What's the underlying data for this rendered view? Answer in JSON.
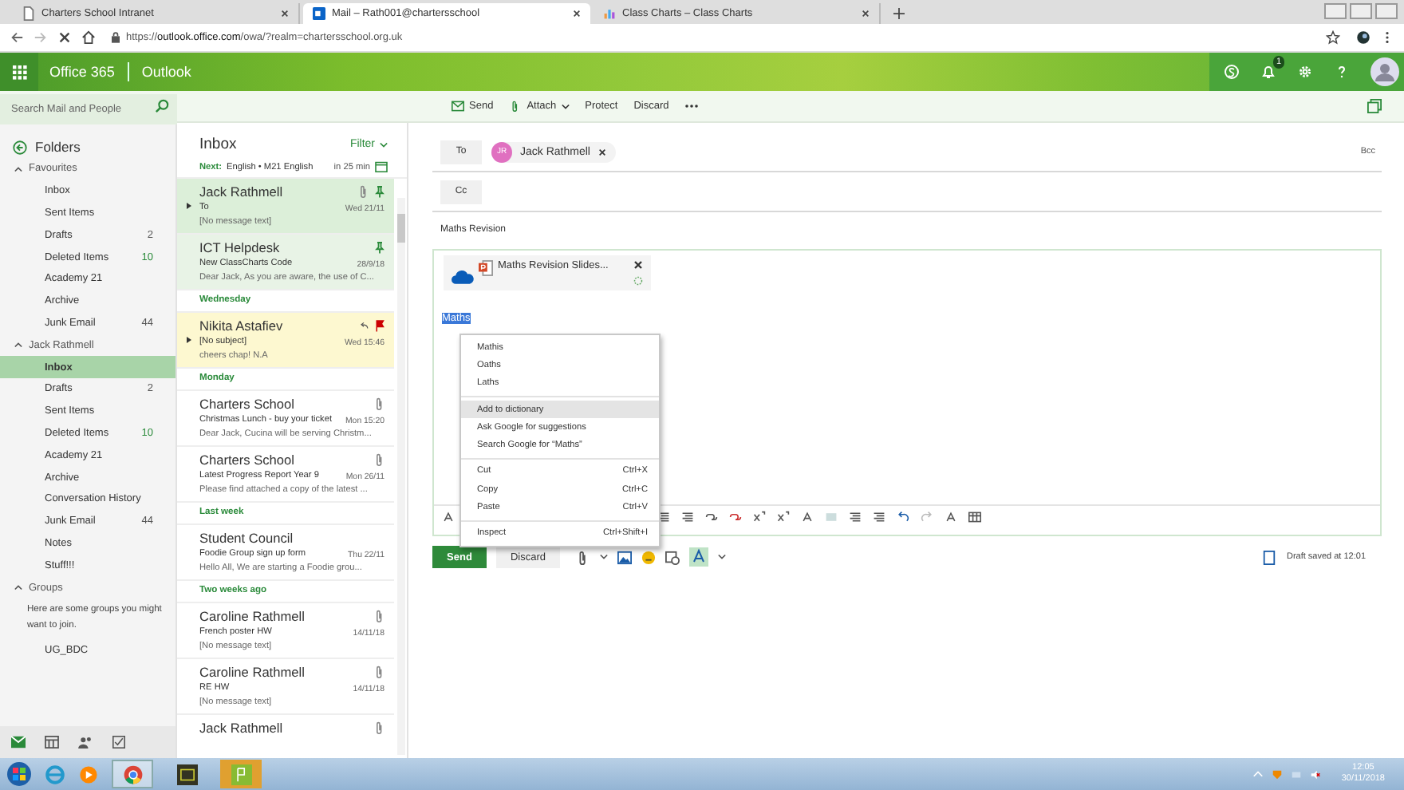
{
  "browser": {
    "tabs": [
      {
        "title": "Charters School Intranet",
        "kind": "page",
        "selected": false
      },
      {
        "title": "Mail – Rath001@chartersschool",
        "kind": "mail",
        "selected": true
      },
      {
        "title": "Class Charts – Class Charts",
        "kind": "chart",
        "selected": false
      }
    ],
    "url": "https://**outlook.office.com**/owa/?realm=chartersschool.org.uk"
  },
  "header": {
    "suite": "Office 365",
    "app": "Outlook",
    "notification_count": "1"
  },
  "search": {
    "placeholder": "Search Mail and People"
  },
  "commands": [
    {
      "label": "Send",
      "kind": "send"
    },
    {
      "label": "Attach",
      "kind": "attach"
    },
    {
      "label": "Protect",
      "kind": "plain"
    },
    {
      "label": "Discard",
      "kind": "plain"
    }
  ],
  "folders": {
    "title": "Folders",
    "sections": [
      {
        "name": "Favourites",
        "expanded": true,
        "items": [
          {
            "name": "Inbox",
            "selected": false
          },
          {
            "name": "Sent Items",
            "selected": false
          },
          {
            "name": "Drafts",
            "count": "2",
            "unread": false,
            "selected": false
          },
          {
            "name": "Deleted Items",
            "count": "10",
            "unread": true,
            "selected": false
          },
          {
            "name": "Academy 21",
            "selected": false
          },
          {
            "name": "Archive",
            "selected": false
          },
          {
            "name": "Junk Email",
            "count": "44",
            "unread": false,
            "selected": false
          }
        ]
      },
      {
        "name": "Jack Rathmell",
        "expanded": true,
        "items": [
          {
            "name": "Inbox",
            "selected": true
          },
          {
            "name": "Drafts",
            "count": "2",
            "unread": false,
            "selected": false
          },
          {
            "name": "Sent Items",
            "selected": false
          },
          {
            "name": "Deleted Items",
            "count": "10",
            "unread": true,
            "selected": false
          },
          {
            "name": "Academy 21",
            "selected": false
          },
          {
            "name": "Archive",
            "selected": false
          },
          {
            "name": "Conversation History",
            "selected": false
          },
          {
            "name": "Junk Email",
            "count": "44",
            "unread": false,
            "selected": false
          },
          {
            "name": "Notes",
            "selected": false
          },
          {
            "name": "Stuff!!!",
            "selected": false
          }
        ]
      },
      {
        "name": "Groups",
        "expanded": true,
        "note": "Here are some groups you might want to join.",
        "items": [
          {
            "name": "UG_BDC",
            "selected": false
          }
        ]
      }
    ]
  },
  "message_list": {
    "title": "Inbox",
    "filter": "Filter",
    "next_label": "Next:",
    "next_event": "English • M21 English",
    "next_time": "in 25 min",
    "items": [
      {
        "kind": "message",
        "sender": "Jack Rathmell",
        "subject": "To",
        "preview": "[No message text]",
        "date": "Wed 21/11",
        "pinned": true,
        "flagged": false,
        "attachment": true,
        "replied": false,
        "thread": true,
        "selected": true
      },
      {
        "kind": "message",
        "sender": "ICT Helpdesk",
        "subject": "New ClassCharts Code",
        "preview": "Dear Jack, As you are aware, the use of C...",
        "date": "28/9/18",
        "pinned": true,
        "flagged": false,
        "attachment": false,
        "replied": false,
        "thread": false,
        "selected": false
      },
      {
        "kind": "heading",
        "text": "Wednesday"
      },
      {
        "kind": "message",
        "sender": "Nikita Astafiev",
        "subject": "[No subject]",
        "preview": "cheers chap!  N.A",
        "date": "Wed 15:46",
        "pinned": false,
        "flagged": true,
        "attachment": false,
        "replied": true,
        "thread": true,
        "selected": false
      },
      {
        "kind": "heading",
        "text": "Monday"
      },
      {
        "kind": "message",
        "sender": "Charters School",
        "subject": "Christmas Lunch - buy your ticket",
        "preview": "Dear Jack, Cucina will be serving Christm...",
        "date": "Mon 15:20",
        "pinned": false,
        "flagged": false,
        "attachment": true,
        "replied": false,
        "thread": false,
        "selected": false
      },
      {
        "kind": "message",
        "sender": "Charters School",
        "subject": "Latest Progress Report Year 9",
        "preview": "Please find attached a copy of the latest ...",
        "date": "Mon 26/11",
        "pinned": false,
        "flagged": false,
        "attachment": true,
        "replied": false,
        "thread": false,
        "selected": false
      },
      {
        "kind": "heading",
        "text": "Last week"
      },
      {
        "kind": "message",
        "sender": "Student Council",
        "subject": "Foodie Group sign up form",
        "preview": "Hello All,   We are starting a Foodie grou...",
        "date": "Thu 22/11",
        "pinned": false,
        "flagged": false,
        "attachment": false,
        "replied": false,
        "thread": false,
        "selected": false
      },
      {
        "kind": "heading",
        "text": "Two weeks ago"
      },
      {
        "kind": "message",
        "sender": "Caroline Rathmell",
        "subject": "French poster HW",
        "preview": "[No message text]",
        "date": "14/11/18",
        "pinned": false,
        "flagged": false,
        "attachment": true,
        "replied": false,
        "thread": false,
        "selected": false
      },
      {
        "kind": "message",
        "sender": "Caroline Rathmell",
        "subject": "RE HW",
        "preview": "[No message text]",
        "date": "14/11/18",
        "pinned": false,
        "flagged": false,
        "attachment": true,
        "replied": false,
        "thread": false,
        "selected": false
      },
      {
        "kind": "message",
        "sender": "Jack Rathmell",
        "pinned": false,
        "flagged": false,
        "attachment": true,
        "replied": false,
        "thread": false,
        "selected": false
      }
    ]
  },
  "compose": {
    "to_label": "To",
    "recipients": [
      {
        "initials": "JR",
        "name": "Jack Rathmell"
      }
    ],
    "bcc": "Bcc",
    "cc_label": "Cc",
    "subject": "Maths Revision",
    "attachment": "Maths Revision Slides...",
    "body_text": "Maths",
    "context_menu": [
      {
        "kind": "item",
        "label": "Mathis",
        "highlighted": false
      },
      {
        "kind": "item",
        "label": "Oaths",
        "highlighted": false
      },
      {
        "kind": "item",
        "label": "Laths",
        "highlighted": false
      },
      {
        "kind": "separator"
      },
      {
        "kind": "item",
        "label": "Add to dictionary",
        "highlighted": true
      },
      {
        "kind": "item",
        "label": "Ask Google for suggestions",
        "highlighted": false
      },
      {
        "kind": "item",
        "label": "Search Google for “Maths”",
        "highlighted": false
      },
      {
        "kind": "separator"
      },
      {
        "kind": "item",
        "label": "Cut",
        "shortcut": "Ctrl+X",
        "highlighted": false
      },
      {
        "kind": "item",
        "label": "Copy",
        "shortcut": "Ctrl+C",
        "highlighted": false
      },
      {
        "kind": "item",
        "label": "Paste",
        "shortcut": "Ctrl+V",
        "highlighted": false
      },
      {
        "kind": "separator"
      },
      {
        "kind": "item",
        "label": "Inspect",
        "shortcut": "Ctrl+Shift+I",
        "highlighted": false
      }
    ],
    "send": "Send",
    "discard": "Discard",
    "draft_status": "Draft saved at 12:01"
  },
  "taskbar": {
    "time": "12:05",
    "date": "30/11/2018"
  }
}
